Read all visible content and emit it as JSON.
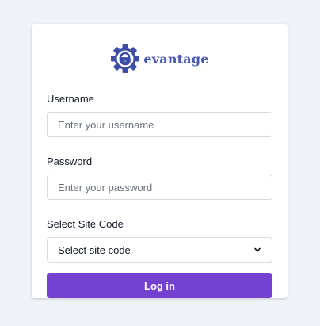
{
  "brand": {
    "logo_text": "evantage",
    "logo_icon": "gear-e-icon"
  },
  "form": {
    "username_label": "Username",
    "username_placeholder": "Enter your username",
    "password_label": "Password",
    "password_placeholder": "Enter your password",
    "site_code_label": "Select Site Code",
    "site_code_selected": "Select site code",
    "login_label": "Log in"
  },
  "colors": {
    "accent": "#7440cf",
    "brand_blue": "#4a58b5",
    "background": "#eff2f7"
  }
}
